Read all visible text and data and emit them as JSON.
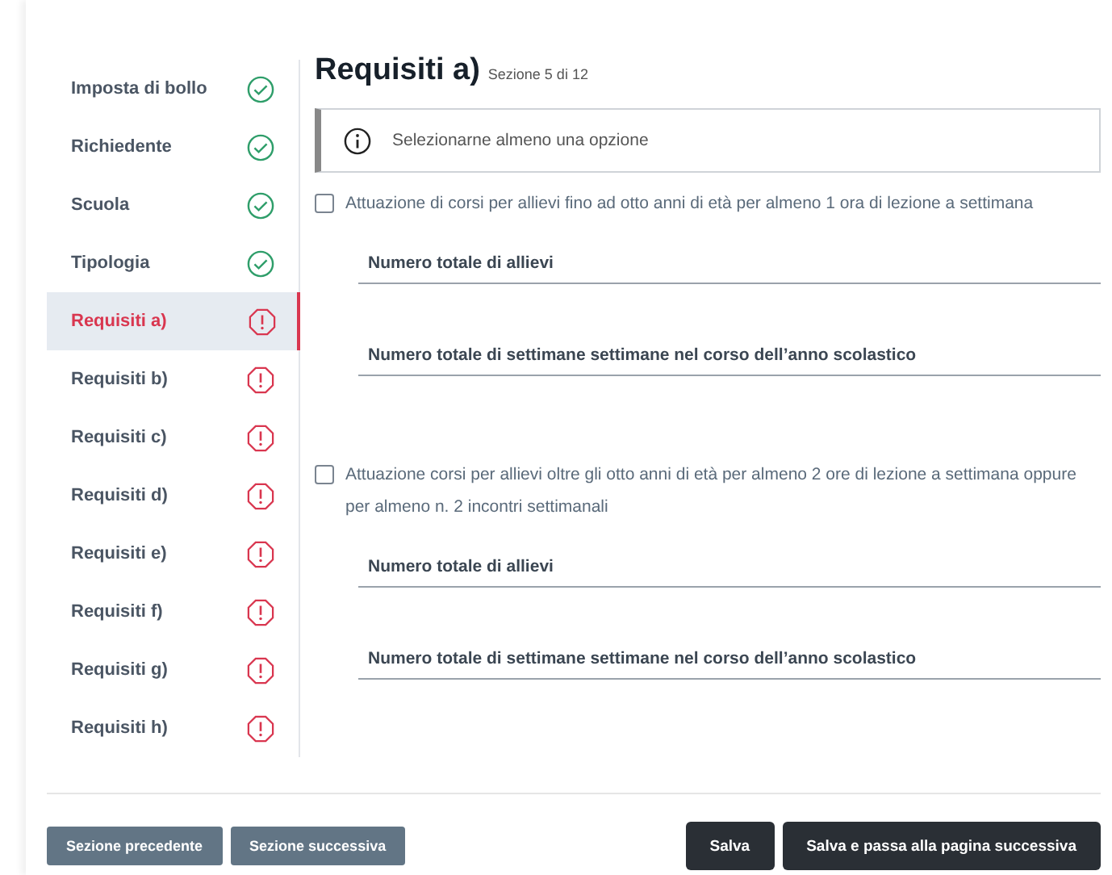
{
  "sidebar": {
    "items": [
      {
        "label": "Imposta di bollo",
        "complete": true,
        "selected": false
      },
      {
        "label": "Richiedente",
        "complete": true,
        "selected": false
      },
      {
        "label": "Scuola",
        "complete": true,
        "selected": false
      },
      {
        "label": "Tipologia",
        "complete": true,
        "selected": false
      },
      {
        "label": "Requisiti a)",
        "complete": false,
        "selected": true
      },
      {
        "label": "Requisiti b)",
        "complete": false,
        "selected": false
      },
      {
        "label": "Requisiti c)",
        "complete": false,
        "selected": false
      },
      {
        "label": "Requisiti d)",
        "complete": false,
        "selected": false
      },
      {
        "label": "Requisiti e)",
        "complete": false,
        "selected": false
      },
      {
        "label": "Requisiti f)",
        "complete": false,
        "selected": false
      },
      {
        "label": "Requisiti g)",
        "complete": false,
        "selected": false
      },
      {
        "label": "Requisiti h)",
        "complete": false,
        "selected": false
      }
    ]
  },
  "section": {
    "title": "Requisiti a)",
    "counter": "Sezione 5 di 12"
  },
  "notice": "Selezionarne almeno una opzione",
  "options": [
    {
      "label": "Attuazione di corsi per allievi fino ad otto anni di età per almeno 1 ora di lezione a settimana",
      "checked": false,
      "fields": [
        {
          "label": "Numero totale di allievi"
        },
        {
          "label": "Numero totale di settimane settimane nel corso dell’anno scolastico"
        }
      ]
    },
    {
      "label": "Attuazione corsi per allievi oltre gli otto anni di età per almeno 2 ore di lezione a settimana oppure per almeno n. 2 incontri settimanali",
      "checked": false,
      "fields": [
        {
          "label": "Numero totale di allievi"
        },
        {
          "label": "Numero totale di settimane settimane nel corso dell’anno scolastico"
        }
      ]
    }
  ],
  "footer": {
    "left_buttons": [
      "Sezione precedente",
      "Sezione successiva"
    ],
    "right_buttons": [
      {
        "label": "Salva"
      },
      {
        "label": "Salva e passa alla pagina successiva"
      }
    ]
  }
}
